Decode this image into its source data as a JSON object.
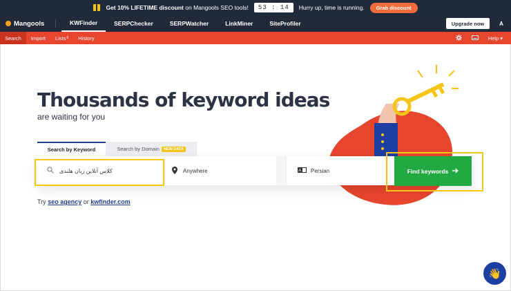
{
  "promo": {
    "offer_bold": "Get 10% LIFETIME discount",
    "offer_rest": "on Mangools SEO tools!",
    "timer": "53 : 14",
    "hurry": "Hurry up, time is running.",
    "grab_label": "Grab discount"
  },
  "nav": {
    "brand": "Mangools",
    "items": [
      "KWFinder",
      "SERPChecker",
      "SERPWatcher",
      "LinkMiner",
      "SiteProfiler"
    ],
    "upgrade_label": "Upgrade now",
    "avatar": "A"
  },
  "subnav": {
    "items": [
      "Search",
      "Import",
      "Lists",
      "History"
    ],
    "lists_badge": "0",
    "help": "Help"
  },
  "hero": {
    "title": "Thousands of keyword ideas",
    "subtitle": "are waiting for you"
  },
  "tabs": {
    "by_keyword": "Search by Keyword",
    "by_domain": "Search by Domain",
    "new_badge": "NEW DATA"
  },
  "search": {
    "keyword_value": "کلاس آنلاین زبان هلندی",
    "location_value": "Anywhere",
    "language_value": "Persian",
    "button_label": "Find keywords"
  },
  "try": {
    "prefix": "Try",
    "link1": "seo agency",
    "or": "or",
    "link2": "kwfinder.com"
  },
  "colors": {
    "accent_red": "#e6452e",
    "button_green": "#23a942",
    "highlight_yellow": "#f5c518",
    "nav_dark": "#222938"
  }
}
